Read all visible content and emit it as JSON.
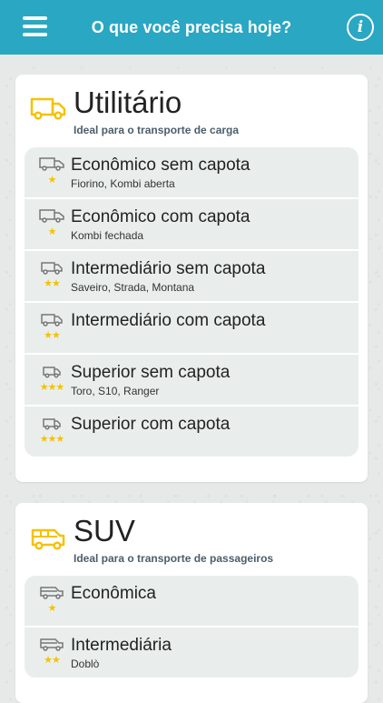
{
  "header": {
    "title": "O que você precisa hoje?",
    "menu_icon": "menu-icon",
    "info_icon": "info-icon",
    "info_glyph": "i",
    "bg_color": "#2aa7c3"
  },
  "accent_color": "#f5c200",
  "sections": [
    {
      "title": "Utilitário",
      "subtitle": "Ideal para o transporte de carga",
      "icon": "van-icon",
      "items": [
        {
          "title": "Econômico sem capota",
          "subtitle": "Fiorino, Kombi aberta",
          "stars": "★",
          "rating": 1,
          "icon": "van-icon"
        },
        {
          "title": "Econômico com capota",
          "subtitle": "Kombi fechada",
          "stars": "★",
          "rating": 1,
          "icon": "van-icon"
        },
        {
          "title": "Intermediário sem capota",
          "subtitle": "Saveiro, Strada, Montana",
          "stars": "★★",
          "rating": 2,
          "icon": "van-icon"
        },
        {
          "title": "Intermediário com capota",
          "subtitle": "",
          "stars": "★★",
          "rating": 2,
          "icon": "van-icon"
        },
        {
          "title": "Superior sem capota",
          "subtitle": "Toro, S10, Ranger",
          "stars": "★★★",
          "rating": 3,
          "icon": "van-icon"
        },
        {
          "title": "Superior com capota",
          "subtitle": "",
          "stars": "★★★",
          "rating": 3,
          "icon": "van-icon"
        }
      ]
    },
    {
      "title": "SUV",
      "subtitle": "Ideal para o transporte de passageiros",
      "icon": "suv-icon",
      "items": [
        {
          "title": "Econômica",
          "subtitle": "",
          "stars": "★",
          "rating": 1,
          "icon": "suv-icon"
        },
        {
          "title": "Intermediária",
          "subtitle": "Doblò",
          "stars": "★★",
          "rating": 2,
          "icon": "suv-icon"
        }
      ]
    }
  ]
}
